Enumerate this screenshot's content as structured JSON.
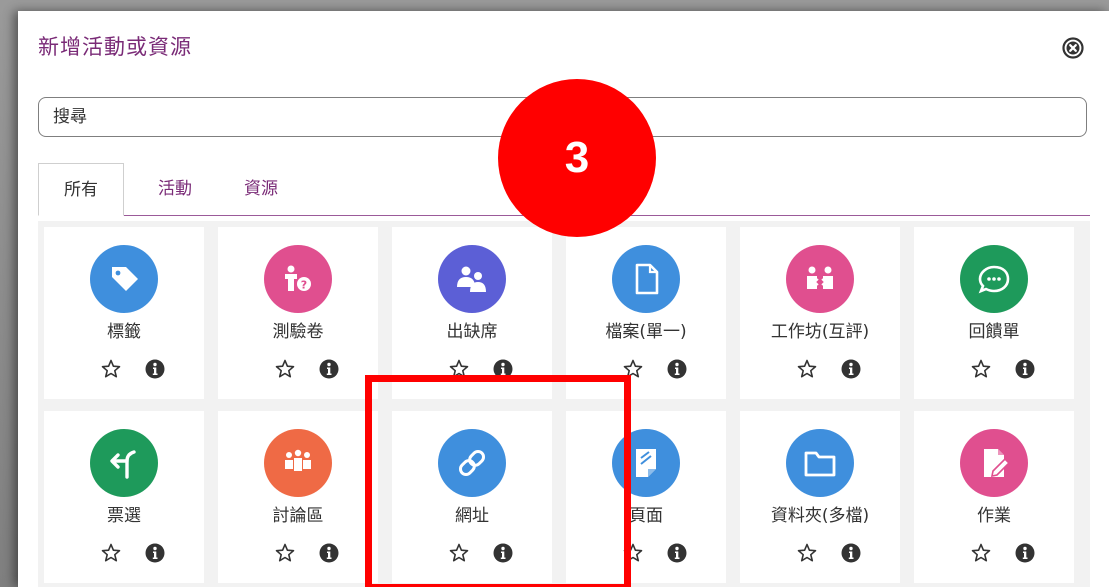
{
  "modal": {
    "title": "新增活動或資源"
  },
  "search": {
    "placeholder": "搜尋"
  },
  "tabs": [
    {
      "label": "所有",
      "active": true
    },
    {
      "label": "活動",
      "active": false
    },
    {
      "label": "資源",
      "active": false
    }
  ],
  "items": [
    {
      "label": "標籤",
      "icon": "tag-icon",
      "color": "#3f8fdd"
    },
    {
      "label": "測驗卷",
      "icon": "quiz-icon",
      "color": "#e04f8f"
    },
    {
      "label": "出缺席",
      "icon": "attendance-icon",
      "color": "#5c5fd6"
    },
    {
      "label": "檔案(單一)",
      "icon": "file-icon",
      "color": "#3f8fdd"
    },
    {
      "label": "工作坊(互評)",
      "icon": "workshop-icon",
      "color": "#e04f8f"
    },
    {
      "label": "回饋單",
      "icon": "feedback-icon",
      "color": "#1e9a5b"
    },
    {
      "label": "票選",
      "icon": "choice-icon",
      "color": "#1e9a5b"
    },
    {
      "label": "討論區",
      "icon": "forum-icon",
      "color": "#ef6a45"
    },
    {
      "label": "網址",
      "icon": "link-icon",
      "color": "#3f8fdd"
    },
    {
      "label": "頁面",
      "icon": "page-icon",
      "color": "#3f8fdd"
    },
    {
      "label": "資料夾(多檔)",
      "icon": "folder-icon",
      "color": "#3f8fdd"
    },
    {
      "label": "作業",
      "icon": "assignment-icon",
      "color": "#e04f8f"
    }
  ],
  "annotation": {
    "step_number": "3",
    "color": "#ff0000"
  }
}
